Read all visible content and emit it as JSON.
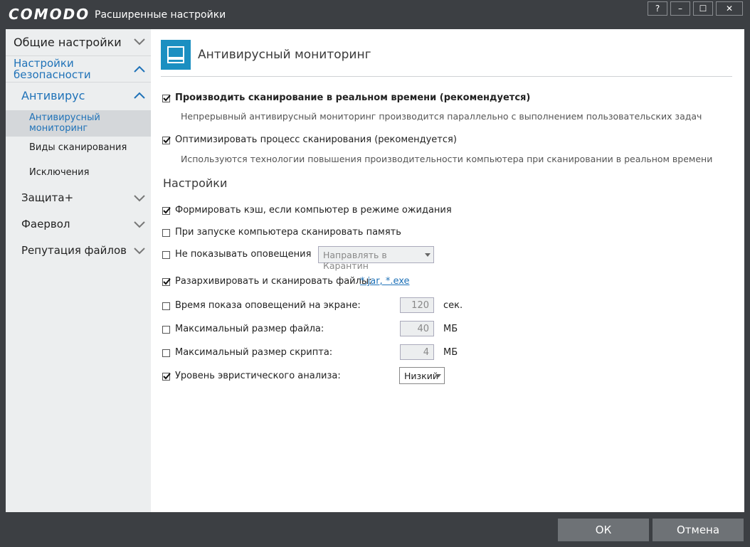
{
  "window": {
    "brand": "COMODO",
    "title": "Расширенные настройки",
    "help": "?",
    "minimize": "–",
    "maximize": "☐",
    "close": "✕"
  },
  "sidebar": {
    "general": "Общие настройки",
    "security": "Настройки безопасности",
    "antivirus": "Антивирус",
    "av_monitoring": "Антивирусный мониторинг",
    "scan_types": "Виды сканирования",
    "exclusions": "Исключения",
    "protection": "Защита+",
    "firewall": "Фаервол",
    "file_reputation": "Репутация файлов"
  },
  "header": {
    "title": "Антивирусный мониторинг"
  },
  "options": {
    "realtime_label": "Производить сканирование в реальном времени (рекомендуется)",
    "realtime_desc": "Непрерывный антивирусный мониторинг производится параллельно с выполнением пользовательских задач",
    "optimize_label": "Оптимизировать процесс сканирования (рекомендуется)",
    "optimize_desc": "Используются технологии повышения производительности компьютера при сканировании в реальном времени"
  },
  "settings": {
    "section_title": "Настройки",
    "cache_label": "Формировать кэш, если компьютер в режиме ожидания",
    "memory_label": "При запуске компьютера сканировать память",
    "no_alerts_label": "Не показывать оповещения",
    "no_alerts_action": "Направлять в Карантин",
    "unpack_label": "Разархивировать и сканировать файлы:",
    "unpack_link": "*.jar, *.exe",
    "alert_time_label": "Время показа оповещений на экране:",
    "alert_time_value": "120",
    "alert_time_unit": "сек.",
    "max_file_label": "Максимальный размер файла:",
    "max_file_value": "40",
    "max_file_unit": "МБ",
    "max_script_label": "Максимальный размер скрипта:",
    "max_script_value": "4",
    "max_script_unit": "МБ",
    "heuristic_label": "Уровень эвристического анализа:",
    "heuristic_value": "Низкий"
  },
  "footer": {
    "ok": "ОК",
    "cancel": "Отмена"
  },
  "colors": {
    "accent": "#1b8fc1",
    "chrome": "#3c3f43",
    "button": "#6e7276",
    "selected": "#d4d7da"
  }
}
